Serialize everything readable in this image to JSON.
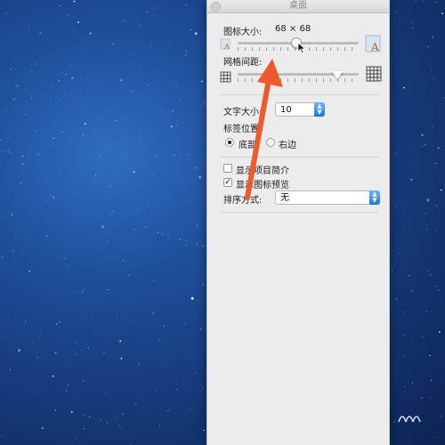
{
  "window": {
    "title": "桌面"
  },
  "icon_size": {
    "label": "图标大小:",
    "value": "68 × 68"
  },
  "grid_spacing": {
    "label": "网格间距:"
  },
  "text_size": {
    "label": "文字大小:",
    "value": "10"
  },
  "label_position": {
    "label": "标签位置:",
    "options": [
      {
        "label": "底部",
        "selected": true
      },
      {
        "label": "右边",
        "selected": false
      }
    ]
  },
  "show_item_info": {
    "label": "显示项目简介",
    "checked": false
  },
  "show_icon_preview": {
    "label": "显示图标预览",
    "checked": true
  },
  "sort_by": {
    "label": "排序方式:",
    "value": "无"
  },
  "accent_color": "#1a73e8",
  "annotation_arrow_color": "#f05a2a",
  "desktop_background": "starry-blue-sky"
}
